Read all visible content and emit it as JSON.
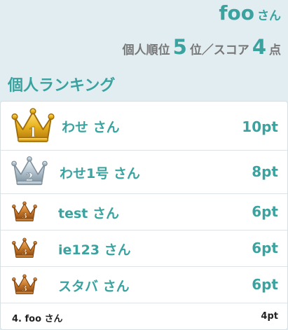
{
  "header": {
    "username": "foo",
    "honorific": "さん",
    "rank_prefix": "個人順位",
    "rank_value": "5",
    "rank_suffix": "位／スコア",
    "score_value": "4",
    "score_suffix": "点"
  },
  "section_title": "個人ランキング",
  "colors": {
    "accent": "#3aa3a0",
    "gold": "#e9b21f",
    "silver": "#b3c3cf",
    "bronze": "#c7792a"
  },
  "ranking": [
    {
      "rank_badge": "1",
      "medal": "gold-crown-icon",
      "name": "わせ さん",
      "score": "10pt"
    },
    {
      "rank_badge": "2",
      "medal": "silver-crown-icon",
      "name": "わせ1号 さん",
      "score": "8pt"
    },
    {
      "rank_badge": "3",
      "medal": "bronze-crown-icon",
      "name": "test さん",
      "score": "6pt"
    },
    {
      "rank_badge": "3",
      "medal": "bronze-crown-icon",
      "name": "ie123 さん",
      "score": "6pt"
    },
    {
      "rank_badge": "3",
      "medal": "bronze-crown-icon",
      "name": "スタバ さん",
      "score": "6pt"
    }
  ],
  "self_row": {
    "label": "4. foo さん",
    "score": "4pt"
  }
}
